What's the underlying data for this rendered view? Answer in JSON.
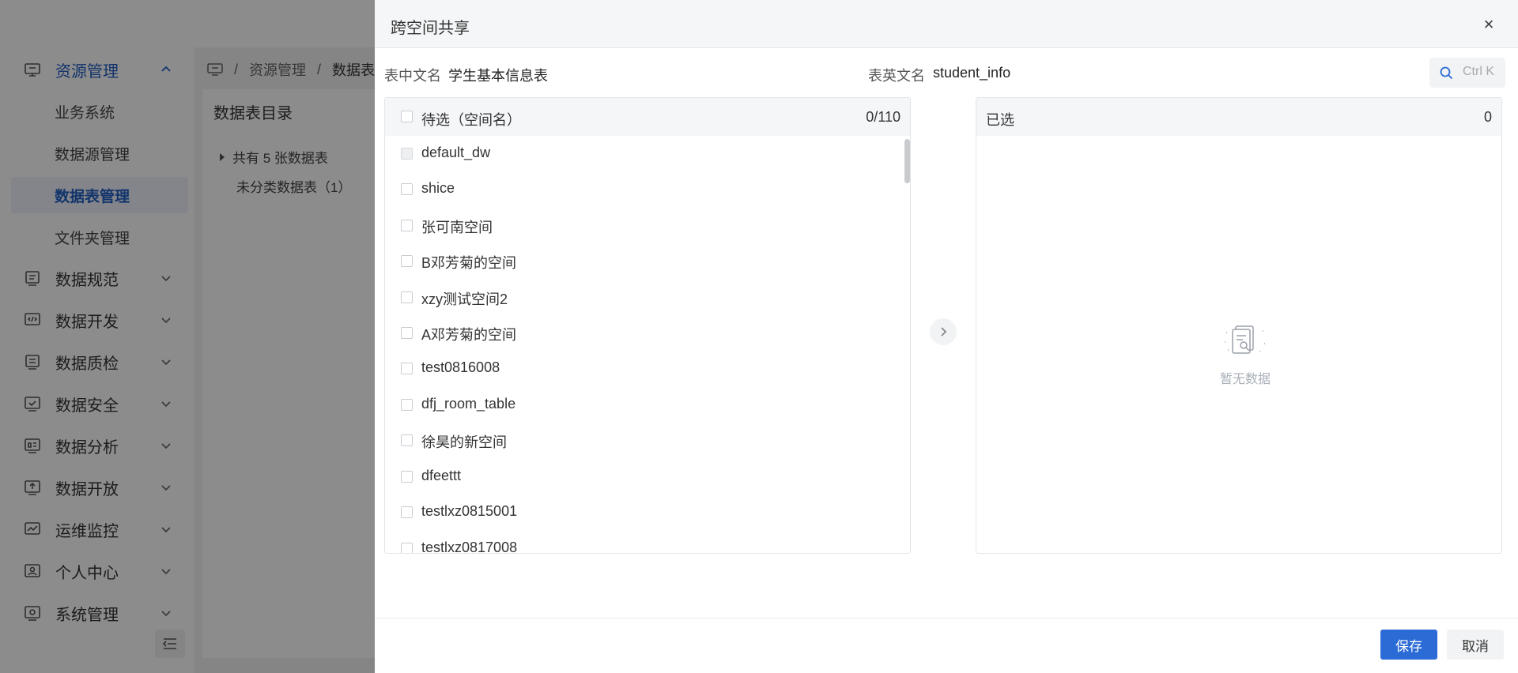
{
  "sidebar": {
    "items": [
      {
        "label": "资源管理",
        "icon": "resource-icon",
        "expanded": true
      },
      {
        "label": "数据规范",
        "icon": "standard-icon"
      },
      {
        "label": "数据开发",
        "icon": "code-icon"
      },
      {
        "label": "数据质检",
        "icon": "quality-icon"
      },
      {
        "label": "数据安全",
        "icon": "security-icon"
      },
      {
        "label": "数据分析",
        "icon": "analysis-icon"
      },
      {
        "label": "数据开放",
        "icon": "open-icon"
      },
      {
        "label": "运维监控",
        "icon": "monitor-icon"
      },
      {
        "label": "个人中心",
        "icon": "user-icon"
      },
      {
        "label": "系统管理",
        "icon": "settings-icon"
      }
    ],
    "sub_items": [
      {
        "label": "业务系统"
      },
      {
        "label": "数据源管理"
      },
      {
        "label": "数据表管理",
        "active": true
      },
      {
        "label": "文件夹管理"
      }
    ]
  },
  "breadcrumb": {
    "items": [
      "资源管理",
      "数据表"
    ],
    "separator": "/"
  },
  "content": {
    "catalog_title": "数据表目录",
    "tree_root": "共有 5 张数据表",
    "tree_child": "未分类数据表（1）"
  },
  "drawer": {
    "title": "跨空间共享",
    "close": "×",
    "cn_name_label": "表中文名",
    "cn_name_value": "学生基本信息表",
    "en_name_label": "表英文名",
    "en_name_value": "student_info",
    "search_placeholder": "Ctrl K",
    "left_panel": {
      "header": "待选（空间名）",
      "count": "0/110",
      "items": [
        {
          "label": "default_dw",
          "disabled": true
        },
        {
          "label": "shice"
        },
        {
          "label": "张可南空间"
        },
        {
          "label": "B邓芳菊的空间"
        },
        {
          "label": "xzy测试空间2"
        },
        {
          "label": "A邓芳菊的空间"
        },
        {
          "label": "test0816008"
        },
        {
          "label": "dfj_room_table"
        },
        {
          "label": "徐昊的新空间"
        },
        {
          "label": "dfeettt"
        },
        {
          "label": "testlxz0815001"
        },
        {
          "label": "testlxz0817008"
        }
      ]
    },
    "right_panel": {
      "header": "已选",
      "count": "0",
      "empty_text": "暂无数据"
    },
    "save_label": "保存",
    "cancel_label": "取消"
  },
  "colors": {
    "primary": "#2b6bd6",
    "active_menu": "#2160c4",
    "mask": "rgba(0,0,0,0.45)"
  }
}
